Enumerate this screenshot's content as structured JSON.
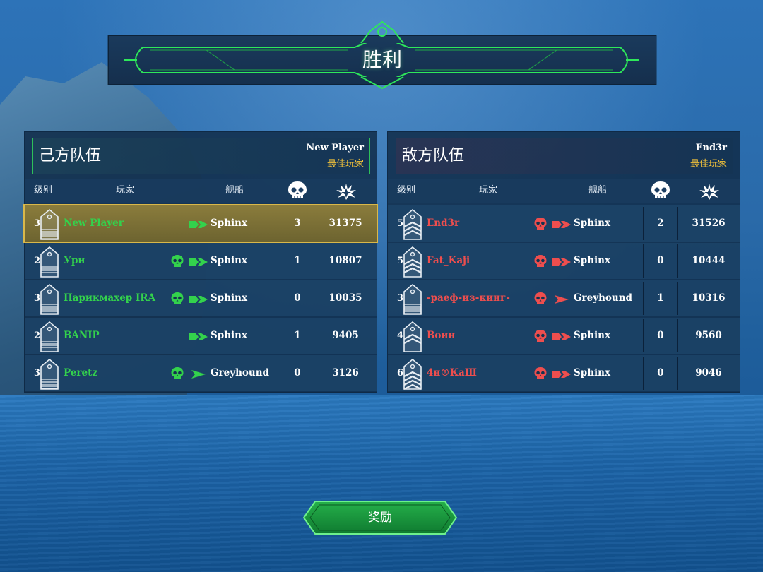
{
  "title": "胜利",
  "colors": {
    "friendly": "#33d24c",
    "enemy": "#ee4e4e",
    "highlight": "#d9b84a",
    "best_label": "#f2c23a"
  },
  "columns": {
    "level": "级别",
    "player": "玩家",
    "ship": "舰船",
    "kills_icon": "skull-icon",
    "score_icon": "explosion-icon"
  },
  "friendly": {
    "team_name": "己方队伍",
    "best_player": "New Player",
    "best_label": "最佳玩家",
    "rows": [
      {
        "level": "3",
        "player": "New Player",
        "ship": "Sphinx",
        "kills": "3",
        "score": "31375",
        "dead": false,
        "highlight": true
      },
      {
        "level": "2",
        "player": "Ури",
        "ship": "Sphinx",
        "kills": "1",
        "score": "10807",
        "dead": true
      },
      {
        "level": "3",
        "player": "Парикмахер IRA",
        "ship": "Sphinx",
        "kills": "0",
        "score": "10035",
        "dead": true
      },
      {
        "level": "2",
        "player": "BANIP",
        "ship": "Sphinx",
        "kills": "1",
        "score": "9405",
        "dead": false
      },
      {
        "level": "3",
        "player": "Peretz",
        "ship": "Greyhound",
        "kills": "0",
        "score": "3126",
        "dead": true
      }
    ]
  },
  "enemy": {
    "team_name": "敌方队伍",
    "best_player": "End3r",
    "best_label": "最佳玩家",
    "rows": [
      {
        "level": "5",
        "player": "End3r",
        "ship": "Sphinx",
        "kills": "2",
        "score": "31526",
        "dead": true
      },
      {
        "level": "5",
        "player": "Fat_Kaji",
        "ship": "Sphinx",
        "kills": "0",
        "score": "10444",
        "dead": true
      },
      {
        "level": "3",
        "player": "-раеф-из-кинг-",
        "ship": "Greyhound",
        "kills": "1",
        "score": "10316",
        "dead": true
      },
      {
        "level": "4",
        "player": "Воин",
        "ship": "Sphinx",
        "kills": "0",
        "score": "9560",
        "dead": true
      },
      {
        "level": "6",
        "player": "4н®КаШ",
        "ship": "Sphinx",
        "kills": "0",
        "score": "9046",
        "dead": true
      }
    ]
  },
  "reward_button": "奖励"
}
